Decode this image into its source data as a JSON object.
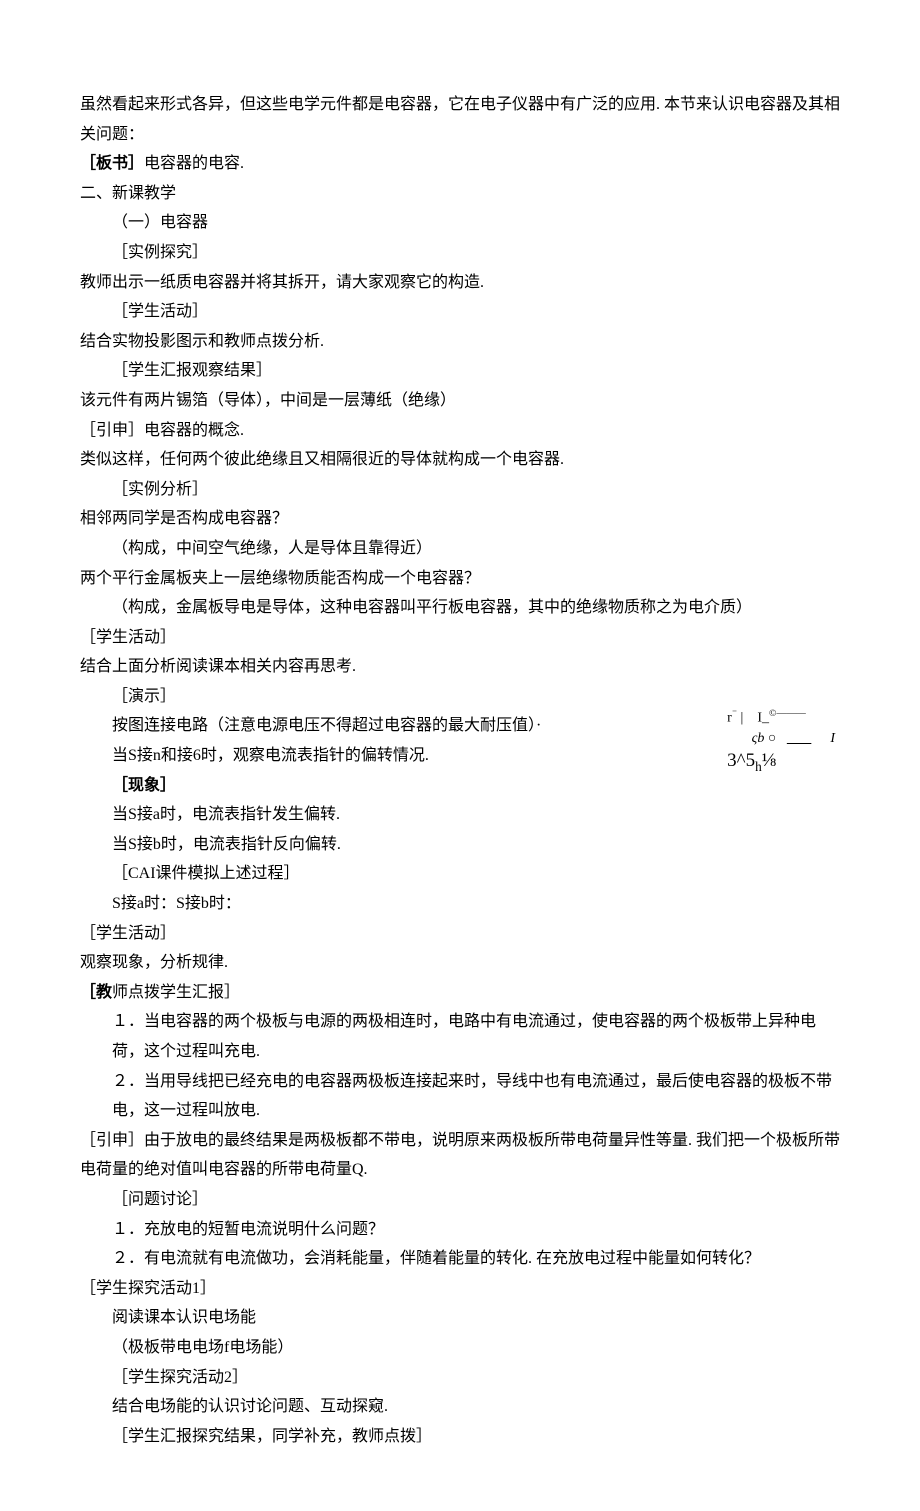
{
  "l1": "虽然看起来形式各异，但这些电学元件都是电容器，它在电子仪器中有广泛的应用. 本节来认识电容器及其相关问题：",
  "l2_label": "［板书］",
  "l2_text": "电容器的电容.",
  "l3": "二、新课教学",
  "l4": "（一）电容器",
  "l5": "［实例探究］",
  "l6": "教师出示一纸质电容器并将其拆开，请大家观察它的构造.",
  "l7": "［学生活动］",
  "l8": "结合实物投影图示和教师点拨分析.",
  "l9": "［学生汇报观察结果］",
  "l10": "该元件有两片锡箔（导体），中间是一层薄纸（绝缘）",
  "l11": "［引申］电容器的概念.",
  "l12": "类似这样，任何两个彼此绝缘且又相隔很近的导体就构成一个电容器.",
  "l13": "［实例分析］",
  "l14": "相邻两同学是否构成电容器？",
  "l15": "（构成，中间空气绝缘，人是导体且靠得近）",
  "l16": "两个平行金属板夹上一层绝缘物质能否构成一个电容器？",
  "l17": "（构成，金属板导电是导体，这种电容器叫平行板电容器，其中的绝缘物质称之为电介质）",
  "l18": "［学生活动］",
  "l19": "结合上面分析阅读课本相关内容再思考.",
  "l20": "［演示］",
  "l21": "按图连接电路（注意电源电压不得超过电容器的最大耐压值）·",
  "l22": "当S接n和接6时，观察电流表指针的偏转情况.",
  "l23": "［现象］",
  "l24": "当S接a时，电流表指针发生偏转.",
  "l25": "当S接b时，电流表指针反向偏转.",
  "l26": "［CAI课件模拟上述过程］",
  "l27": "S接a时：S接b时：",
  "l28": "［学生活动］",
  "l29": "观察现象，分析规律.",
  "l30_label": "［教",
  "l30_text": "师点拨学生汇报］",
  "l31": "１．当电容器的两个极板与电源的两极相连时，电路中有电流通过，使电容器的两个极板带上异种电荷，这个过程叫充电.",
  "l32": "２．当用导线把已经充电的电容器两极板连接起来时，导线中也有电流通过，最后使电容器的极板不带电，这一过程叫放电.",
  "l33": "［引申］由于放电的最终结果是两极板都不带电，说明原来两极板所带电荷量异性等量. 我们把一个极板所带电荷量的绝对值叫电容器的所带电荷量Q.",
  "l34": "［问题讨论］",
  "l35": "１．充放电的短暂电流说明什么问题？",
  "l36": "２．有电流就有电流做功，会消耗能量，伴随着能量的转化. 在充放电过程中能量如何转化？",
  "l37": "［学生探究活动1］",
  "l38": "阅读课本认识电场能",
  "l39": "（极板带电电场f电场能）",
  "l40": "［学生探究活动2］",
  "l41": "结合电场能的认识讨论问题、互动探窥.",
  "l42": "［学生汇报探究结果，同学补充，教师点拨］",
  "formula": {
    "a": "r",
    "b": "⁻",
    "c": "|",
    "d": "I_",
    "e": "©———",
    "f": "ς",
    "g": "b ○",
    "h": "I",
    "i": "3^5",
    "j": "h",
    "k": "⅛"
  }
}
